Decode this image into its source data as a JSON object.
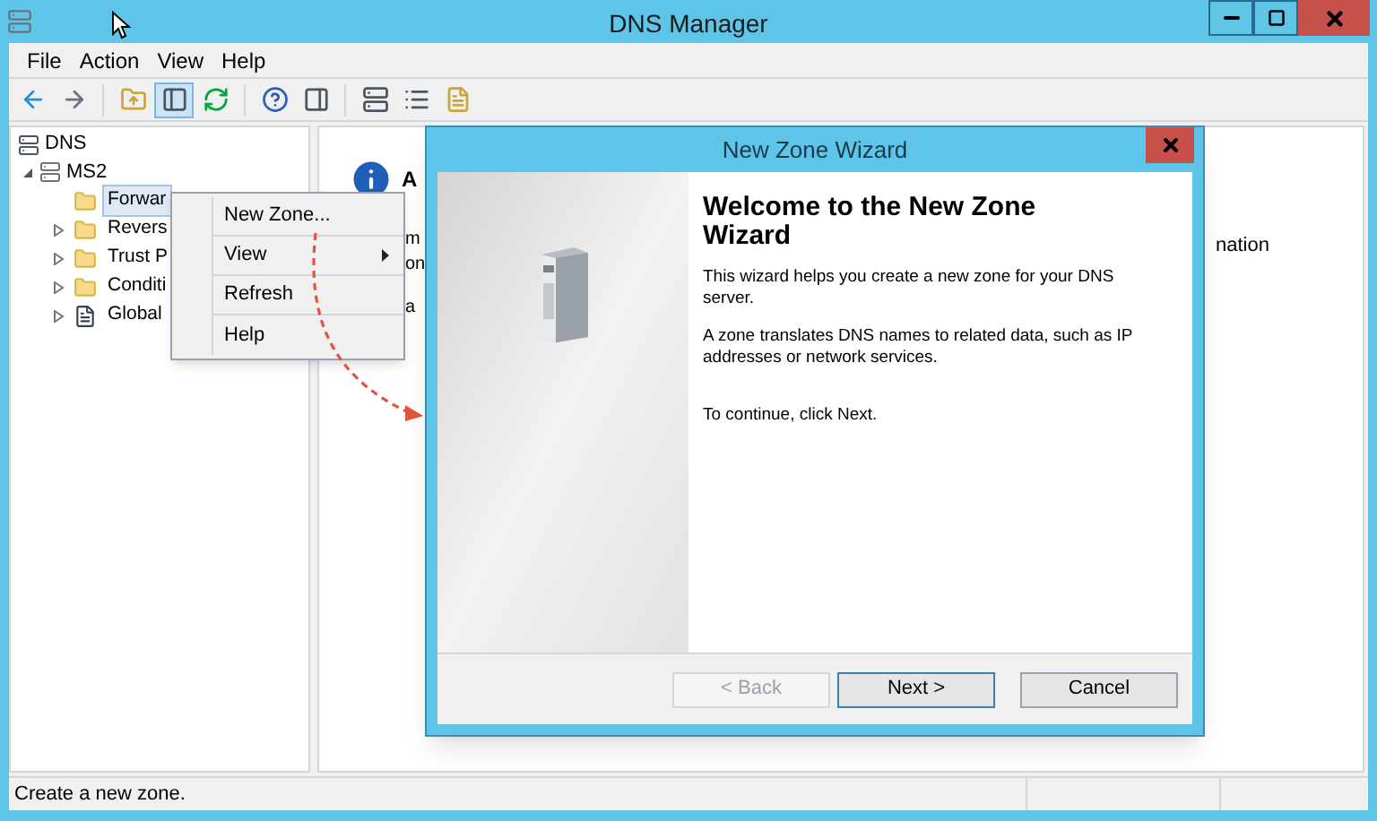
{
  "window": {
    "title": "DNS Manager"
  },
  "menu": [
    "File",
    "Action",
    "View",
    "Help"
  ],
  "toolbar": [
    {
      "kind": "back",
      "pressed": false
    },
    {
      "kind": "forward",
      "pressed": false
    },
    {
      "kind": "sep"
    },
    {
      "kind": "up",
      "pressed": false
    },
    {
      "kind": "tree",
      "pressed": true
    },
    {
      "kind": "refresh",
      "pressed": false
    },
    {
      "kind": "sep"
    },
    {
      "kind": "help",
      "pressed": false
    },
    {
      "kind": "pane",
      "pressed": false
    },
    {
      "kind": "sep"
    },
    {
      "kind": "server",
      "pressed": false
    },
    {
      "kind": "list",
      "pressed": false
    },
    {
      "kind": "zone",
      "pressed": false
    }
  ],
  "tree": {
    "label": "DNS",
    "children": [
      {
        "label": "MS2",
        "expanded": true,
        "children": [
          {
            "label": "Forwar",
            "kind": "folder",
            "expander": false,
            "selected": true
          },
          {
            "label": "Revers",
            "kind": "folder",
            "expander": true,
            "selected": false
          },
          {
            "label": "Trust P",
            "kind": "folder",
            "expander": true,
            "selected": false
          },
          {
            "label": "Conditi",
            "kind": "folder",
            "expander": true,
            "selected": false
          },
          {
            "label": "Global",
            "kind": "log",
            "expander": true,
            "selected": false
          }
        ]
      }
    ]
  },
  "context_menu": [
    {
      "label": "New Zone...",
      "submenu": false
    },
    {
      "label": "View",
      "submenu": true
    },
    {
      "label": "Refresh",
      "submenu": false
    },
    {
      "label": "Help",
      "submenu": false
    }
  ],
  "details_pane": {
    "heading": "A",
    "lines": [
      "m",
      "on"
    ],
    "line_after": "a",
    "right_text": "nation"
  },
  "dialog": {
    "title": "New Zone Wizard",
    "heading": "Welcome to the New Zone Wizard",
    "paragraphs": [
      "This wizard helps you create a new zone for your DNS server.",
      "A zone translates DNS names to related data, such as IP addresses or network services."
    ],
    "closing": "To continue, click Next.",
    "buttons": [
      {
        "label": "< Back",
        "disabled": true,
        "default": false
      },
      {
        "label": "Next >",
        "disabled": false,
        "default": true
      },
      {
        "label": "Cancel",
        "disabled": false,
        "default": false
      }
    ]
  },
  "status_bar": {
    "text": "Create a new zone."
  }
}
